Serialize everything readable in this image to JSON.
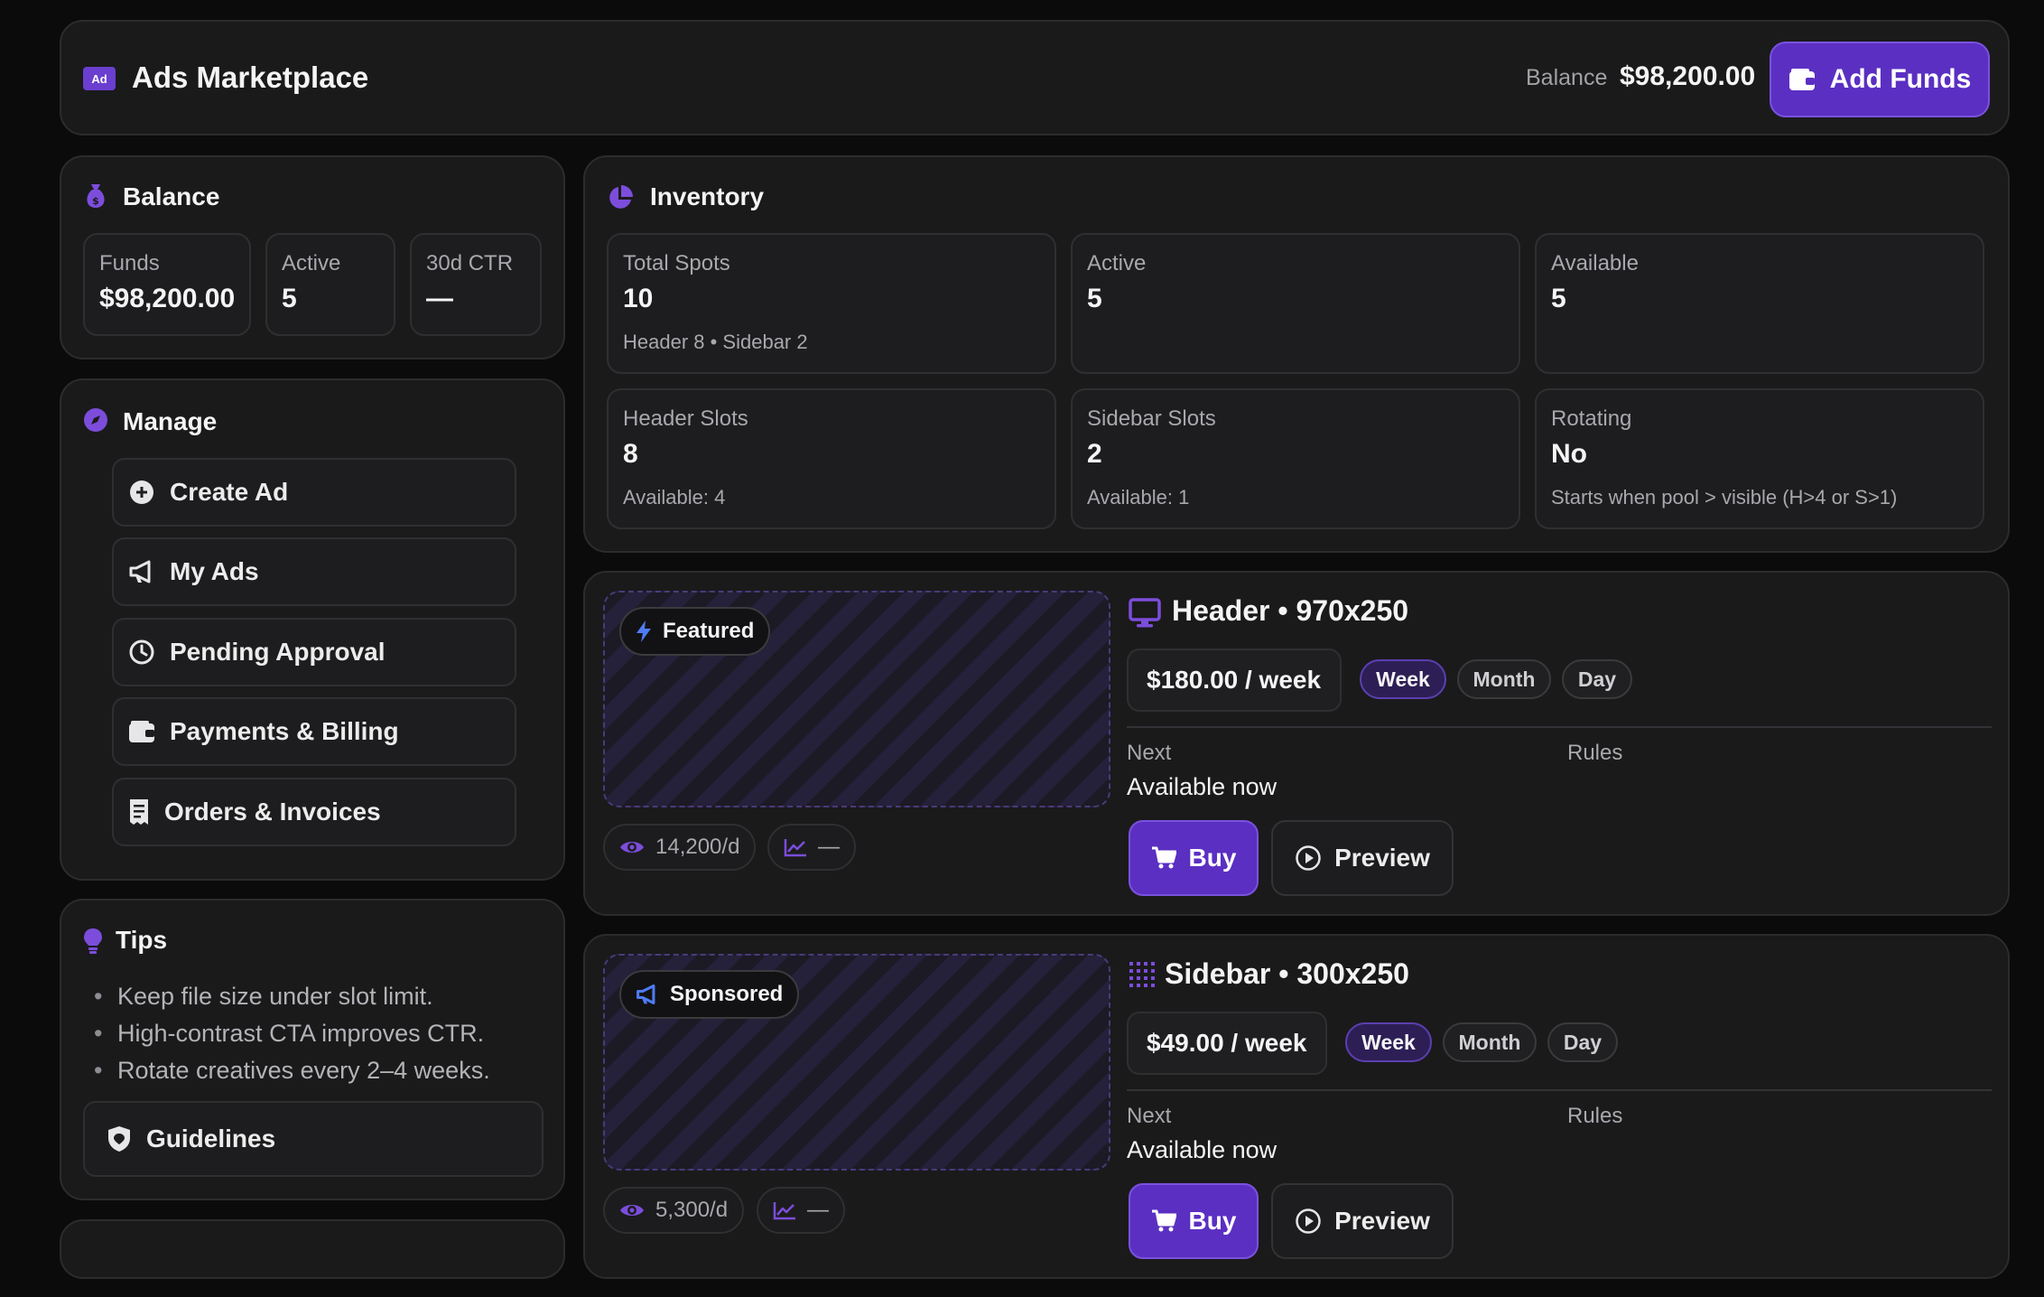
{
  "header": {
    "logo_text": "Ad",
    "title": "Ads Marketplace",
    "balance_label": "Balance",
    "balance_value": "$98,200.00",
    "add_funds_label": "Add Funds"
  },
  "balance": {
    "title": "Balance",
    "stats": [
      {
        "label": "Funds",
        "value": "$98,200.00"
      },
      {
        "label": "Active",
        "value": "5"
      },
      {
        "label": "30d CTR",
        "value": "—"
      }
    ]
  },
  "manage": {
    "title": "Manage",
    "items": [
      {
        "label": "Create Ad",
        "icon": "plus-circle-icon"
      },
      {
        "label": "My Ads",
        "icon": "megaphone-icon"
      },
      {
        "label": "Pending Approval",
        "icon": "clock-icon"
      },
      {
        "label": "Payments & Billing",
        "icon": "wallet-icon"
      },
      {
        "label": "Orders & Invoices",
        "icon": "receipt-icon"
      }
    ]
  },
  "tips": {
    "title": "Tips",
    "items": [
      "Keep file size under slot limit.",
      "High-contrast CTA improves CTR.",
      "Rotate creatives every 2–4 weeks."
    ],
    "guidelines_label": "Guidelines"
  },
  "inventory": {
    "title": "Inventory",
    "tiles": [
      {
        "label": "Total Spots",
        "value": "10",
        "sub": "Header 8 • Sidebar 2"
      },
      {
        "label": "Active",
        "value": "5",
        "sub": ""
      },
      {
        "label": "Available",
        "value": "5",
        "sub": ""
      },
      {
        "label": "Header Slots",
        "value": "8",
        "sub": "Available: 4"
      },
      {
        "label": "Sidebar Slots",
        "value": "2",
        "sub": "Available: 1"
      },
      {
        "label": "Rotating",
        "value": "No",
        "sub": "Starts when pool > visible (H>4 or S>1)"
      }
    ]
  },
  "listings": [
    {
      "badge": "Featured",
      "badge_icon": "bolt-icon",
      "title": "Header • 970x250",
      "title_icon": "monitor-icon",
      "price": "$180.00 / week",
      "periods": [
        "Week",
        "Month",
        "Day"
      ],
      "selected_period": "Week",
      "views": "14,200/d",
      "ctr": "—",
      "next_label": "Next",
      "next_value": "Available now",
      "rules_label": "Rules",
      "buy_label": "Buy",
      "preview_label": "Preview"
    },
    {
      "badge": "Sponsored",
      "badge_icon": "megaphone-icon",
      "title": "Sidebar • 300x250",
      "title_icon": "grid-icon",
      "price": "$49.00 / week",
      "periods": [
        "Week",
        "Month",
        "Day"
      ],
      "selected_period": "Week",
      "views": "5,300/d",
      "ctr": "—",
      "next_label": "Next",
      "next_value": "Available now",
      "rules_label": "Rules",
      "buy_label": "Buy",
      "preview_label": "Preview"
    }
  ],
  "colors": {
    "accent": "#5b2fc2",
    "accent_light": "#7c4ddb",
    "background": "#0b0b0c",
    "card": "#1a1a1b"
  }
}
